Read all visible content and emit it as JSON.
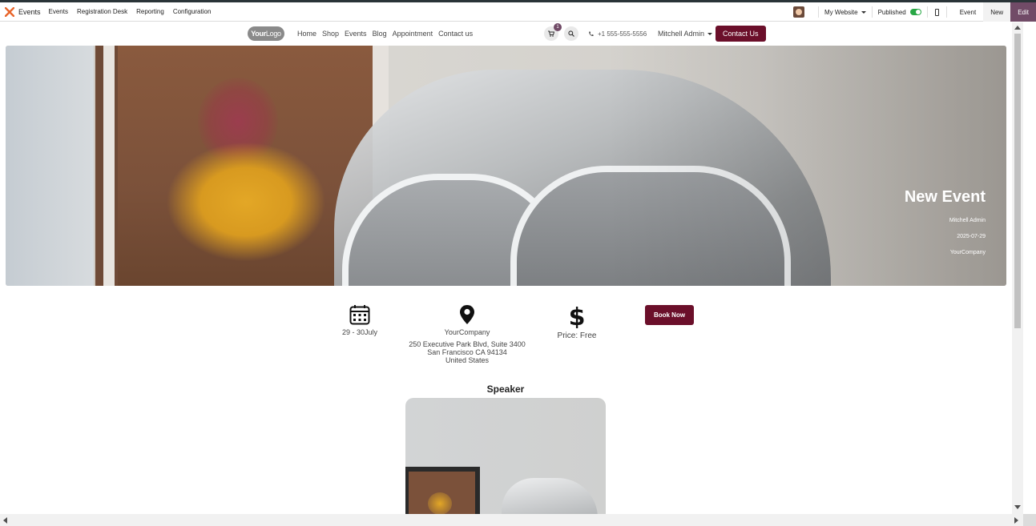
{
  "admin": {
    "app_name": "Events",
    "menus": [
      "Events",
      "Registration Desk",
      "Reporting",
      "Configuration"
    ],
    "my_website": "My Website",
    "published": "Published",
    "btn_event": "Event",
    "btn_new": "New",
    "btn_edit": "Edit"
  },
  "site": {
    "logo_bold": "Your",
    "logo_rest": "Logo",
    "nav": [
      "Home",
      "Shop",
      "Events",
      "Blog",
      "Appointment",
      "Contact us"
    ],
    "cart_count": "1",
    "phone": "+1 555-555-5556",
    "user": "Mitchell Admin",
    "contact_button": "Contact Us"
  },
  "hero": {
    "title": "New Event",
    "organizer": "Mitchell Admin",
    "date": "2025-07-29",
    "company": "YourCompany"
  },
  "info": {
    "dates": "29 - 30July",
    "venue_name": "YourCompany",
    "address_line1": "250 Executive Park Blvd, Suite 3400",
    "address_line2": "San Francisco CA 94134",
    "address_line3": "United States",
    "price": "Price: Free",
    "book_button": "Book Now"
  },
  "speaker": {
    "heading": "Speaker"
  },
  "colors": {
    "brand": "#714b67",
    "accent": "#6b0f2a",
    "toggle_on": "#28a745"
  }
}
